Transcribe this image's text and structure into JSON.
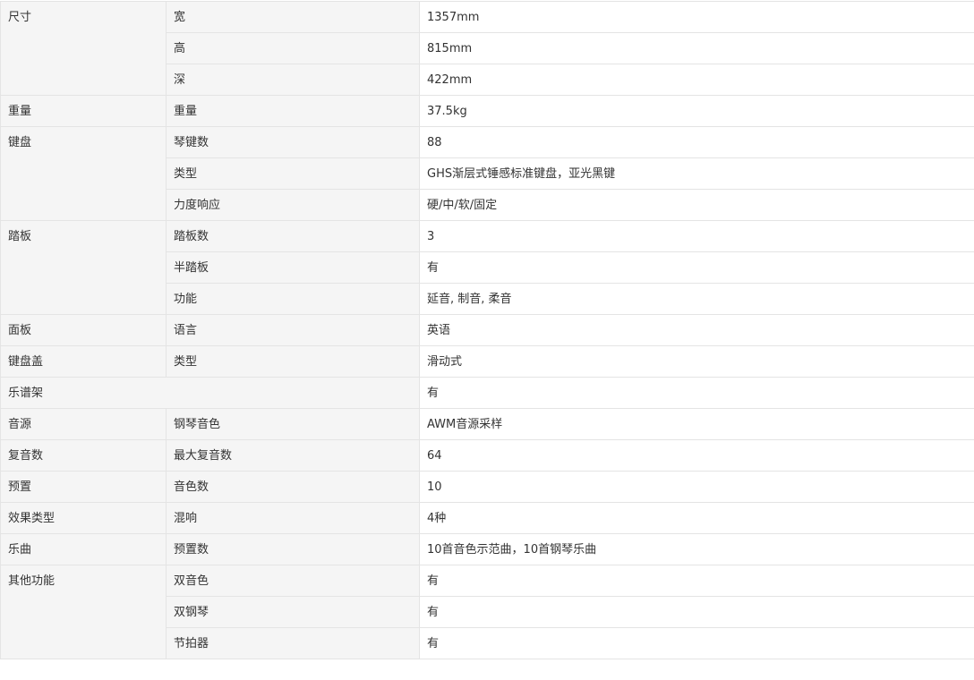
{
  "spec_table": {
    "rows": [
      {
        "category": "尺寸",
        "sub": "宽",
        "value": "1357mm"
      },
      {
        "category": "",
        "sub": "高",
        "value": "815mm"
      },
      {
        "category": "",
        "sub": "深",
        "value": "422mm"
      },
      {
        "category": "重量",
        "sub": "重量",
        "value": "37.5kg"
      },
      {
        "category": "键盘",
        "sub": "琴键数",
        "value": "88"
      },
      {
        "category": "",
        "sub": "类型",
        "value": "GHS渐层式锤感标准键盘，亚光黑键"
      },
      {
        "category": "",
        "sub": "力度响应",
        "value": "硬/中/软/固定"
      },
      {
        "category": "踏板",
        "sub": "踏板数",
        "value": "3"
      },
      {
        "category": "",
        "sub": "半踏板",
        "value": "有"
      },
      {
        "category": "",
        "sub": "功能",
        "value": "延音, 制音, 柔音"
      },
      {
        "category": "面板",
        "sub": "语言",
        "value": "英语"
      },
      {
        "category": "键盘盖",
        "sub": "类型",
        "value": "滑动式"
      },
      {
        "category": "乐谱架",
        "sub": "",
        "value": "有"
      },
      {
        "category": "音源",
        "sub": "钢琴音色",
        "value": "AWM音源采样"
      },
      {
        "category": "复音数",
        "sub": "最大复音数",
        "value": "64"
      },
      {
        "category": "预置",
        "sub": "音色数",
        "value": "10"
      },
      {
        "category": "效果类型",
        "sub": "混响",
        "value": "4种"
      },
      {
        "category": "乐曲",
        "sub": "预置数",
        "value": "10首音色示范曲，10首钢琴乐曲"
      },
      {
        "category": "其他功能",
        "sub": "双音色",
        "value": "有"
      },
      {
        "category": "",
        "sub": "双钢琴",
        "value": "有"
      },
      {
        "category": "",
        "sub": "节拍器",
        "value": "有"
      }
    ]
  }
}
